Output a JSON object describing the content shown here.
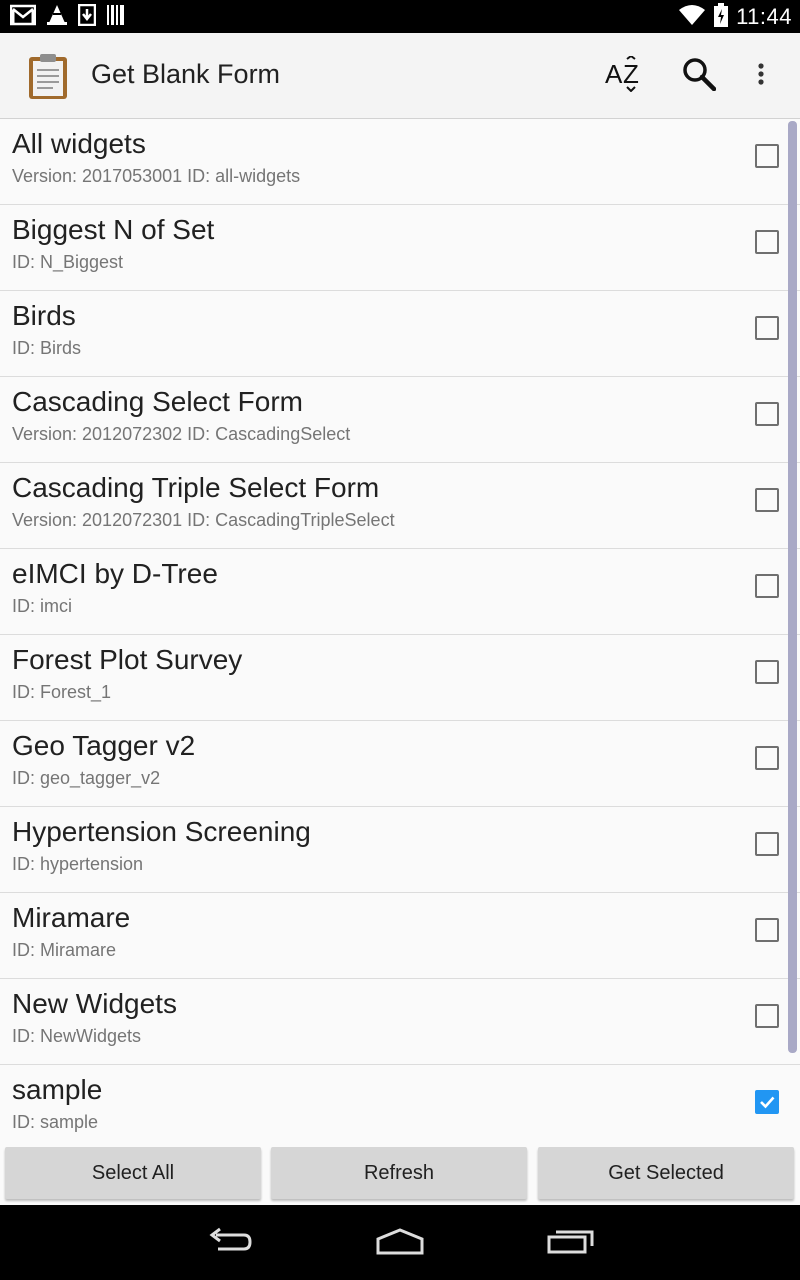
{
  "status_bar": {
    "time": "11:44",
    "left_icons": [
      "gmail-icon",
      "vlc-cone-icon",
      "download-icon",
      "barcode-icon"
    ],
    "right_icons": [
      "wifi-icon",
      "battery-charging-icon"
    ]
  },
  "action_bar": {
    "title": "Get Blank Form",
    "icons": [
      "clipboard-app-icon",
      "sort-az-icon",
      "search-icon",
      "overflow-menu-icon"
    ]
  },
  "forms": [
    {
      "name": "All widgets",
      "detail": "Version: 2017053001 ID: all-widgets",
      "checked": false
    },
    {
      "name": "Biggest N of Set",
      "detail": "ID: N_Biggest",
      "checked": false
    },
    {
      "name": "Birds",
      "detail": "ID: Birds",
      "checked": false
    },
    {
      "name": "Cascading Select Form",
      "detail": "Version: 2012072302 ID: CascadingSelect",
      "checked": false
    },
    {
      "name": "Cascading Triple Select Form",
      "detail": "Version: 2012072301 ID: CascadingTripleSelect",
      "checked": false
    },
    {
      "name": "eIMCI by D-Tree",
      "detail": "ID: imci",
      "checked": false
    },
    {
      "name": "Forest Plot Survey",
      "detail": "ID: Forest_1",
      "checked": false
    },
    {
      "name": "Geo Tagger v2",
      "detail": "ID: geo_tagger_v2",
      "checked": false
    },
    {
      "name": "Hypertension Screening",
      "detail": "ID: hypertension",
      "checked": false
    },
    {
      "name": "Miramare",
      "detail": "ID: Miramare",
      "checked": false
    },
    {
      "name": "New Widgets",
      "detail": "ID: NewWidgets",
      "checked": false
    },
    {
      "name": "sample",
      "detail": "ID: sample",
      "checked": true
    }
  ],
  "buttons": {
    "select_all": "Select All",
    "refresh": "Refresh",
    "get_selected": "Get Selected"
  },
  "nav_bar": {
    "icons": [
      "back-icon",
      "home-icon",
      "recents-icon"
    ]
  },
  "colors": {
    "checkbox_checked": "#2196f3",
    "scrollbar": "#a9a9c6"
  }
}
